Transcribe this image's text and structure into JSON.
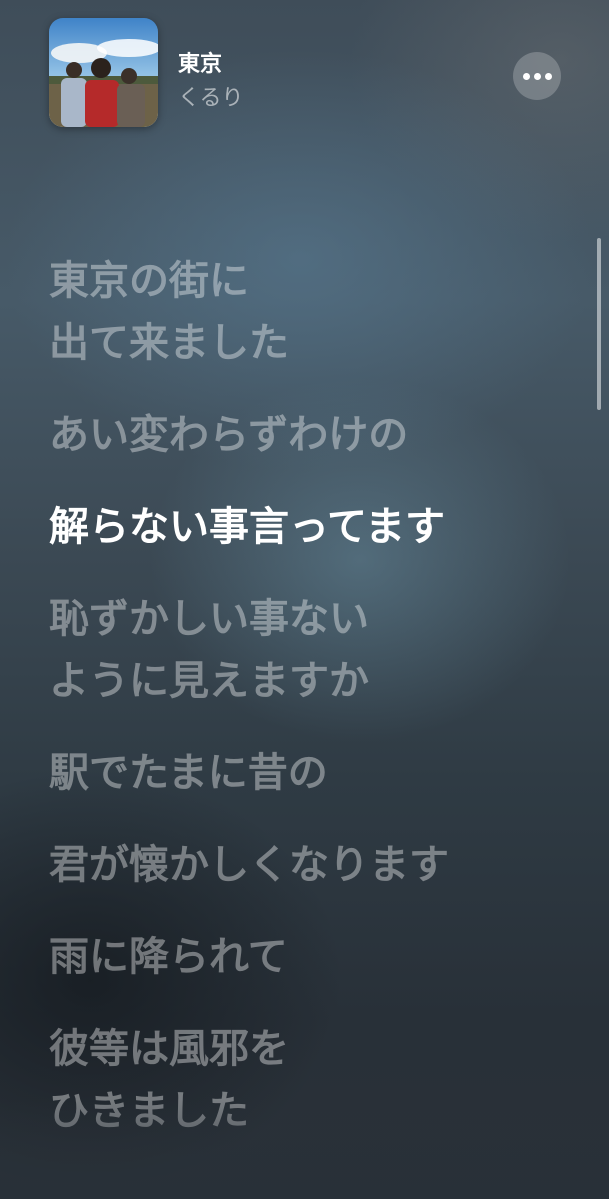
{
  "now_playing": {
    "title": "東京",
    "artist": "くるり",
    "artwork_icon": "album-artwork"
  },
  "more_button": {
    "icon": "more-horizontal-icon"
  },
  "lyrics": [
    {
      "text": "東京の街に\n出て来ました",
      "active": false
    },
    {
      "text": "あい変わらずわけの",
      "active": false
    },
    {
      "text": "解らない事言ってます",
      "active": true
    },
    {
      "text": "恥ずかしい事ない\nように見えますか",
      "active": false
    },
    {
      "text": "駅でたまに昔の",
      "active": false
    },
    {
      "text": "君が懐かしくなります",
      "active": false
    },
    {
      "text": "雨に降られて",
      "active": false
    },
    {
      "text": "彼等は風邪を\nひきました",
      "active": false
    }
  ],
  "colors": {
    "active_lyric": "#ffffff",
    "inactive_lyric": "rgba(255,255,255,0.38)"
  }
}
